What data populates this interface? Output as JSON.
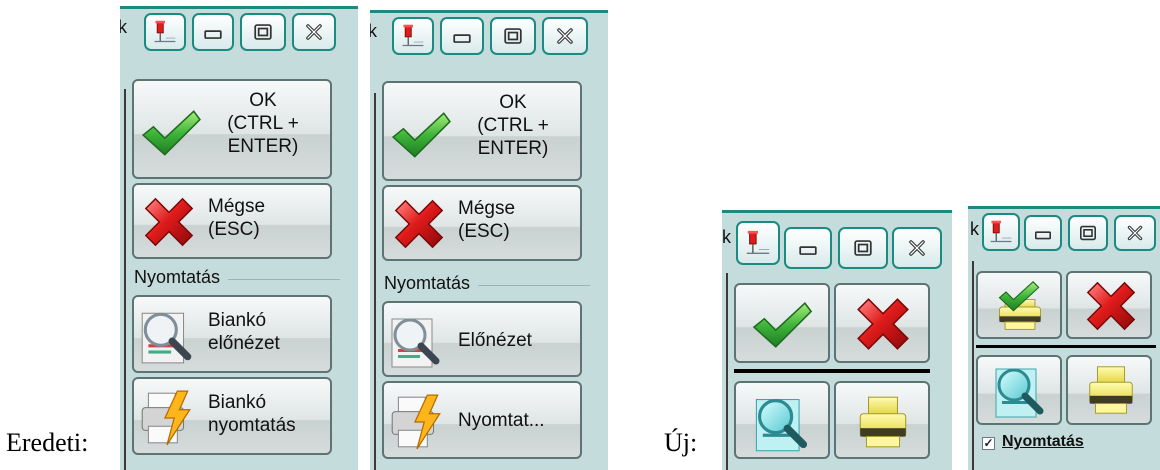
{
  "captions": {
    "original": "Eredeti:",
    "new": "Új:"
  },
  "titlebar": {
    "cut_text": "k"
  },
  "panel1": {
    "ok_label": "OK\n(CTRL +\nENTER)",
    "cancel_label": "Mégse\n(ESC)",
    "section_label": "Nyomtatás",
    "preview_label": "Biankó\nelőnézet",
    "print_label": "Biankó\nnyomtatás"
  },
  "panel2": {
    "ok_label": "OK\n(CTRL +\nENTER)",
    "cancel_label": "Mégse\n(ESC)",
    "section_label": "Nyomtatás",
    "preview_label": "Előnézet",
    "print_label": "Nyomtat..."
  },
  "panel4": {
    "checkbox_label": "Nyomtatás",
    "checkbox_checked": true
  },
  "icons": [
    "pin-icon",
    "minimize-icon",
    "restore-icon",
    "close-icon",
    "check-icon",
    "cross-icon",
    "preview-magnifier-icon",
    "print-lightning-icon",
    "printer-icon",
    "print-check-icon"
  ],
  "colors": {
    "frame_border": "#1b8a80",
    "panel_bg": "#c5dcdc",
    "ok_green": "#3aa83a",
    "cancel_red": "#d01818",
    "print_yellow": "#f4ea62"
  }
}
